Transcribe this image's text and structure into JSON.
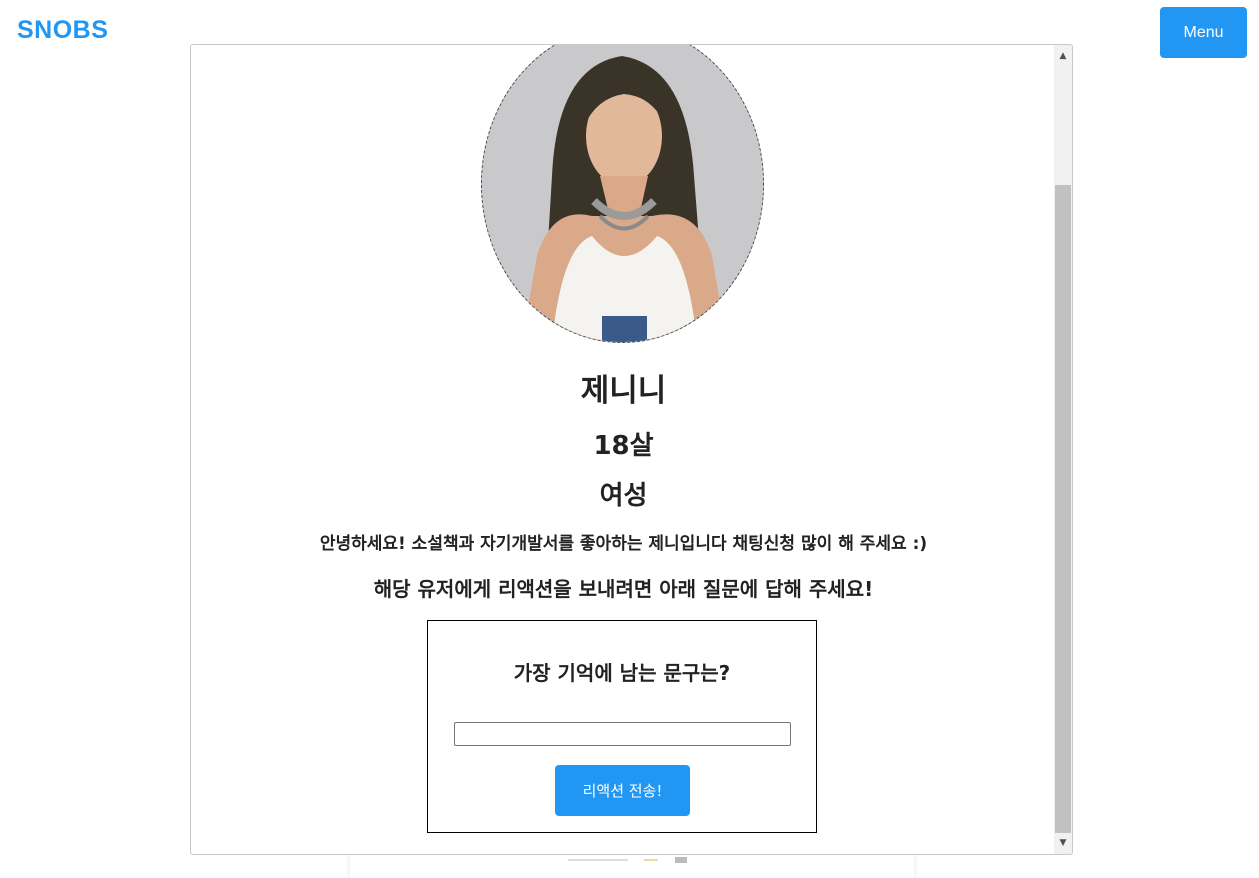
{
  "header": {
    "logo": "SNOBS",
    "menu_label": "Menu"
  },
  "profile": {
    "name": "제니니",
    "age": "18살",
    "gender": "여성",
    "bio": "안녕하세요! 소설책과 자기개발서를 좋아하는 제니입니다 채팅신청 많이 해 주세요 :)",
    "reaction_prompt": "해당 유저에게 리액션을 보내려면 아래 질문에 답해 주세요!"
  },
  "reaction_form": {
    "question": "가장 기억에 남는 문구는?",
    "answer_value": "",
    "answer_placeholder": "",
    "submit_label": "리액션 전송!"
  },
  "colors": {
    "accent": "#2196f3",
    "text": "#222222"
  }
}
